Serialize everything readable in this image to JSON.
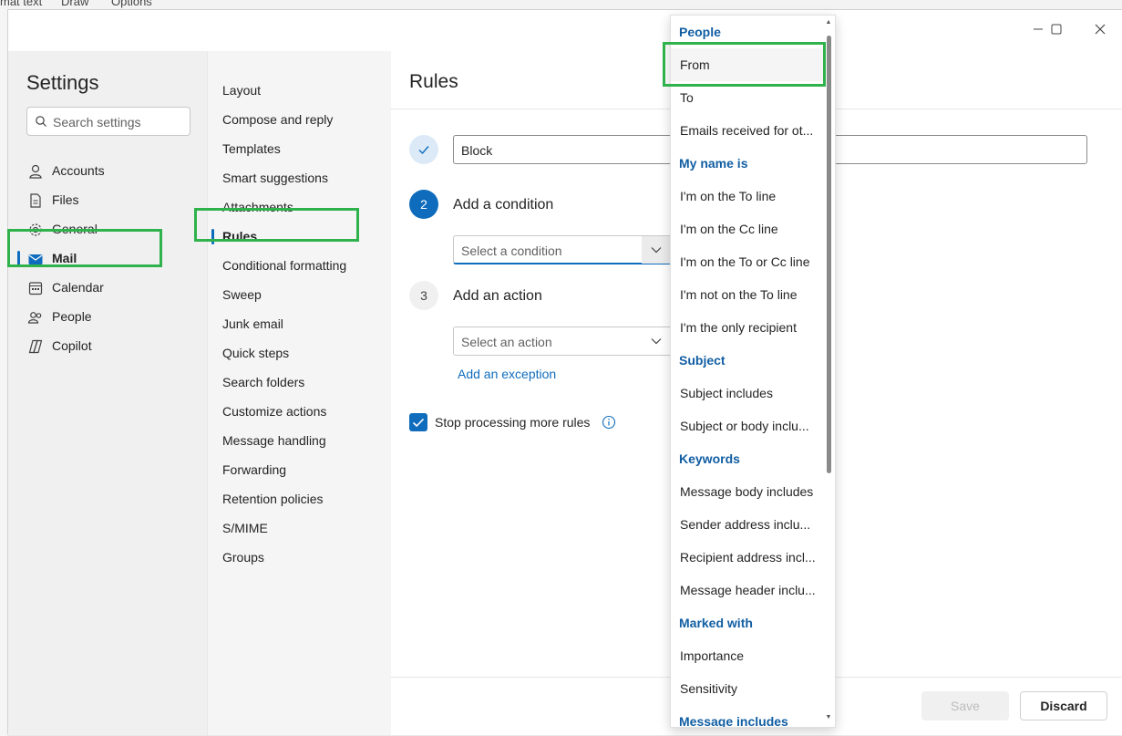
{
  "background_app": {
    "tabs": [
      "mat text",
      "Draw",
      "Options"
    ]
  },
  "settings": {
    "title": "Settings",
    "search_placeholder": "Search settings",
    "nav": [
      {
        "label": "Accounts",
        "icon": "person-icon"
      },
      {
        "label": "Files",
        "icon": "file-icon"
      },
      {
        "label": "General",
        "icon": "gear-icon"
      },
      {
        "label": "Mail",
        "icon": "mail-icon",
        "selected": true
      },
      {
        "label": "Calendar",
        "icon": "calendar-icon"
      },
      {
        "label": "People",
        "icon": "people-icon"
      },
      {
        "label": "Copilot",
        "icon": "copilot-icon"
      }
    ]
  },
  "mail_nav": [
    {
      "label": "Layout"
    },
    {
      "label": "Compose and reply"
    },
    {
      "label": "Templates"
    },
    {
      "label": "Smart suggestions"
    },
    {
      "label": "Attachments"
    },
    {
      "label": "Rules",
      "selected": true
    },
    {
      "label": "Conditional formatting"
    },
    {
      "label": "Sweep"
    },
    {
      "label": "Junk email"
    },
    {
      "label": "Quick steps"
    },
    {
      "label": "Search folders"
    },
    {
      "label": "Customize actions"
    },
    {
      "label": "Message handling"
    },
    {
      "label": "Forwarding"
    },
    {
      "label": "Retention policies"
    },
    {
      "label": "S/MIME"
    },
    {
      "label": "Groups"
    }
  ],
  "rules": {
    "title": "Rules",
    "rule_name_value": "Block",
    "step2": {
      "number": "2",
      "label": "Add a condition",
      "placeholder": "Select a condition"
    },
    "step3": {
      "number": "3",
      "label": "Add an action",
      "placeholder": "Select an action"
    },
    "add_exception": "Add an exception",
    "stop_processing": {
      "label": "Stop processing more rules",
      "checked": true
    },
    "save_label": "Save",
    "discard_label": "Discard"
  },
  "dropdown": {
    "items": [
      {
        "type": "header",
        "label": "People"
      },
      {
        "type": "option",
        "label": "From",
        "hover": true
      },
      {
        "type": "option",
        "label": "To"
      },
      {
        "type": "option",
        "label": "Emails received for ot..."
      },
      {
        "type": "header",
        "label": "My name is"
      },
      {
        "type": "option",
        "label": "I'm on the To line"
      },
      {
        "type": "option",
        "label": "I'm on the Cc line"
      },
      {
        "type": "option",
        "label": "I'm on the To or Cc line"
      },
      {
        "type": "option",
        "label": "I'm not on the To line"
      },
      {
        "type": "option",
        "label": "I'm the only recipient"
      },
      {
        "type": "header",
        "label": "Subject"
      },
      {
        "type": "option",
        "label": "Subject includes"
      },
      {
        "type": "option",
        "label": "Subject or body inclu..."
      },
      {
        "type": "header",
        "label": "Keywords"
      },
      {
        "type": "option",
        "label": "Message body includes"
      },
      {
        "type": "option",
        "label": "Sender address inclu..."
      },
      {
        "type": "option",
        "label": "Recipient address incl..."
      },
      {
        "type": "option",
        "label": "Message header inclu..."
      },
      {
        "type": "header",
        "label": "Marked with"
      },
      {
        "type": "option",
        "label": "Importance"
      },
      {
        "type": "option",
        "label": "Sensitivity"
      },
      {
        "type": "header",
        "label": "Message includes"
      }
    ]
  },
  "colors": {
    "accent": "#0f6cbd",
    "header_text": "#115ea3",
    "highlight": "#2fb24c"
  }
}
